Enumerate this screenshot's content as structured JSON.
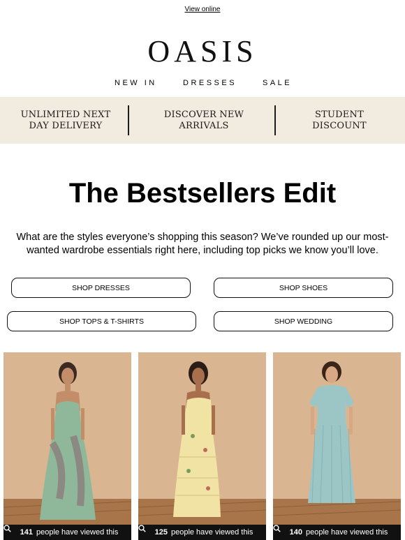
{
  "header": {
    "view_online": "View online",
    "logo": "OASIS"
  },
  "nav": [
    {
      "label": "NEW IN"
    },
    {
      "label": "DRESSES"
    },
    {
      "label": "SALE"
    }
  ],
  "usps": [
    {
      "label": "UNLIMITED NEXT DAY DELIVERY"
    },
    {
      "label": "DISCOVER NEW ARRIVALS"
    },
    {
      "label": "STUDENT DISCOUNT"
    }
  ],
  "hero": {
    "title": "The Bestsellers Edit",
    "intro": "What are the styles everyone’s shopping this season? We’ve rounded up our most-wanted wardrobe essentials right here, including top picks we know you’ll love."
  },
  "ctas": [
    {
      "label": "SHOP DRESSES"
    },
    {
      "label": "SHOP SHOES"
    },
    {
      "label": "SHOP TOPS & T-SHIRTS"
    },
    {
      "label": "SHOP WEDDING"
    }
  ],
  "products": [
    {
      "count": "141",
      "suffix": "people have viewed this",
      "dress_color": "#8fb89a",
      "icon": "search-icon"
    },
    {
      "count": "125",
      "suffix": "people have viewed this",
      "dress_color": "#f1e3a4",
      "icon": "search-icon"
    },
    {
      "count": "140",
      "suffix": "people have viewed this",
      "dress_color": "#9cc6c6",
      "icon": "search-icon"
    }
  ],
  "colors": {
    "usp_background": "#f1ebe0",
    "photo_background": "#d8b38e",
    "badge_background": "#111111"
  }
}
